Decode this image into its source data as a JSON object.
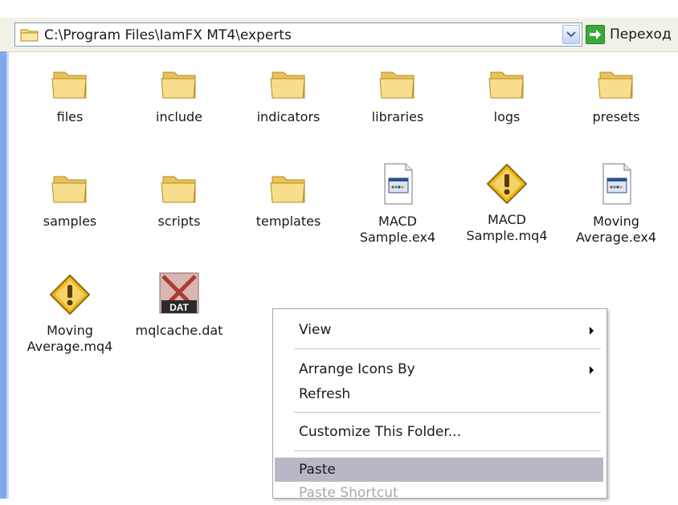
{
  "address": {
    "path": "C:\\Program Files\\IamFX MT4\\experts",
    "folder_icon": "folder-icon",
    "dropdown_icon": "chevron-down-icon",
    "go_label": "Переход",
    "go_icon": "green-arrow-icon"
  },
  "files": [
    {
      "name": "files",
      "icon": "folder-icon"
    },
    {
      "name": "include",
      "icon": "folder-icon"
    },
    {
      "name": "indicators",
      "icon": "folder-icon"
    },
    {
      "name": "libraries",
      "icon": "folder-icon"
    },
    {
      "name": "logs",
      "icon": "folder-icon"
    },
    {
      "name": "presets",
      "icon": "folder-icon"
    },
    {
      "name": "samples",
      "icon": "folder-icon"
    },
    {
      "name": "scripts",
      "icon": "folder-icon"
    },
    {
      "name": "templates",
      "icon": "folder-icon"
    },
    {
      "name": "MACD\nSample.ex4",
      "icon": "ex4-file-icon"
    },
    {
      "name": "MACD\nSample.mq4",
      "icon": "mq4-warning-icon"
    },
    {
      "name": "Moving\nAverage.ex4",
      "icon": "ex4-file-icon"
    },
    {
      "name": "Moving\nAverage.mq4",
      "icon": "mq4-warning-icon"
    },
    {
      "name": "mqlcache.dat",
      "icon": "dat-file-icon"
    }
  ],
  "dat_badge": "DAT",
  "context_menu": {
    "items": [
      {
        "label": "View",
        "submenu": true
      },
      {
        "label": "Arrange Icons By",
        "submenu": true
      },
      {
        "label": "Refresh"
      },
      {
        "label": "Customize This Folder..."
      },
      {
        "label": "Paste",
        "highlighted": true
      },
      {
        "label": "Paste Shortcut",
        "disabled": true
      }
    ]
  },
  "colors": {
    "folder": "#f4d46c",
    "highlight": "#b7b7c5",
    "left_band": "#7fa9ec",
    "warning": "#f0b820"
  }
}
